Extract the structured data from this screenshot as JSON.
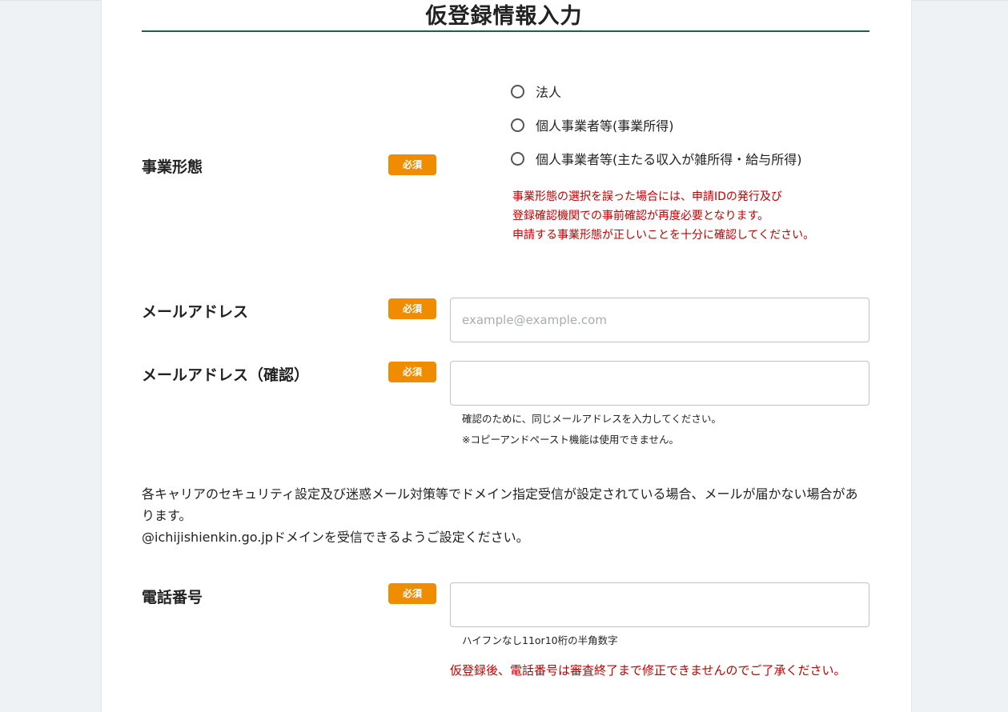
{
  "page": {
    "title": "仮登録情報入力"
  },
  "business_type": {
    "label": "事業形態",
    "required": "必須",
    "options": [
      {
        "label": "法人"
      },
      {
        "label": "個人事業者等(事業所得)"
      },
      {
        "label": "個人事業者等(主たる収入が雑所得・給与所得)"
      }
    ],
    "warning_lines": [
      "事業形態の選択を誤った場合には、申請IDの発行及び",
      "登録確認機関での事前確認が再度必要となります。",
      "申請する事業形態が正しいことを十分に確認してください。"
    ]
  },
  "email": {
    "label": "メールアドレス",
    "required": "必須",
    "placeholder": "example@example.com",
    "value": ""
  },
  "email_confirm": {
    "label": "メールアドレス（確認）",
    "required": "必須",
    "value": "",
    "notes": [
      "確認のために、同じメールアドレスを入力してください。",
      "※コピーアンドペースト機能は使用できません。"
    ]
  },
  "domain_info": {
    "line1": "各キャリアのセキュリティ設定及び迷惑メール対策等でドメイン指定受信が設定されている場合、メールが届かない場合があります。",
    "line2": "@ichijishienkin.go.jpドメインを受信できるようご設定ください。"
  },
  "phone": {
    "label": "電話番号",
    "required": "必須",
    "value": "",
    "note": "ハイフンなし11or10桁の半角数字",
    "warning": "仮登録後、電話番号は審査終了まで修正できませんのでご了承ください。"
  },
  "colors": {
    "required_badge": "#f08c00",
    "warning_text": "#c00000",
    "title_rule": "#1f5f4f"
  }
}
